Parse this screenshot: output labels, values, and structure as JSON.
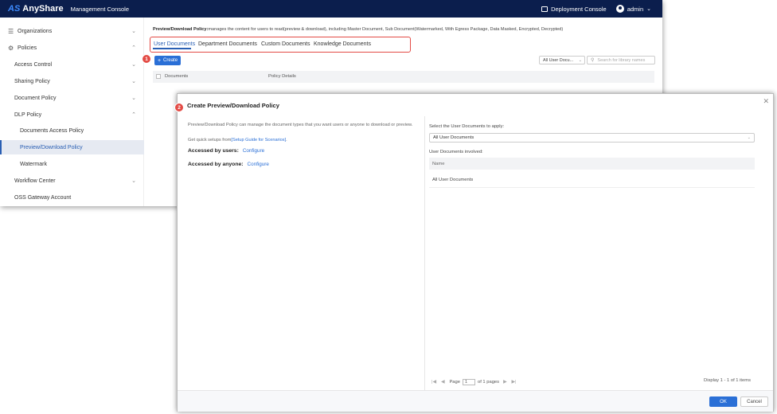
{
  "topbar": {
    "logo_mark": "AS",
    "logo_text": "AnyShare",
    "console_title": "Management Console",
    "deployment_label": "Deployment Console",
    "user_label": "admin"
  },
  "sidebar": {
    "items": [
      {
        "label": "Organizations",
        "icon": "org-icon",
        "chevron": "v"
      },
      {
        "label": "Policies",
        "icon": "policy-icon",
        "chevron": "^"
      },
      {
        "label": "Access Control",
        "chevron": "v"
      },
      {
        "label": "Sharing Policy",
        "chevron": "v"
      },
      {
        "label": "Document Policy",
        "chevron": "v"
      },
      {
        "label": "DLP Policy",
        "chevron": "^"
      },
      {
        "label": "Documents Access Policy"
      },
      {
        "label": "Preview/Download Policy",
        "active": true
      },
      {
        "label": "Watermark"
      },
      {
        "label": "Workflow Center",
        "chevron": "v"
      },
      {
        "label": "OSS Gateway Account"
      }
    ]
  },
  "main": {
    "desc_title": "Preview/Download Policy:",
    "desc_text": "manages the content for users to read(preview & download), including Master Document, Sub Document(Watermarked, With Egress Package, Data Masked, Encrypted, Decrypted)",
    "tabs": [
      {
        "label": "User Documents"
      },
      {
        "label": "Department Documents"
      },
      {
        "label": "Custom Documents"
      },
      {
        "label": "Knowledge Documents"
      }
    ],
    "create_label": "Create",
    "filter_value": "All User Docu...",
    "search_placeholder": "Search for library names",
    "columns": [
      "Documents",
      "Policy Details"
    ]
  },
  "badges": [
    "1",
    "2"
  ],
  "dialog": {
    "title": "Create Preview/Download Policy",
    "intro": "Preview/Download Policy can manage the document types that you want users or anyone to download or preview.",
    "setup_prefix": "Get quick setups from",
    "setup_link": "[Setup Guide for Scenarios]",
    "setup_suffix": ".",
    "accessed_users": "Accessed by users:",
    "accessed_anyone": "Accessed by anyone:",
    "configure": "Configure",
    "select_label": "Select the User Documents to apply:",
    "select_value": "All User Documents",
    "involved_label": "User Documents involved:",
    "name_header": "Name",
    "rows": [
      "All User Documents"
    ],
    "pager": {
      "page_label": "Page",
      "page_value": "1",
      "of_pages": "of 1 pages"
    },
    "display_text": "Display 1 - 1 of 1 items",
    "ok_label": "OK",
    "cancel_label": "Cancel"
  },
  "colors": {
    "topbar": "#0b1e4d",
    "accent": "#2a6fd6",
    "highlight": "#e34b45"
  }
}
